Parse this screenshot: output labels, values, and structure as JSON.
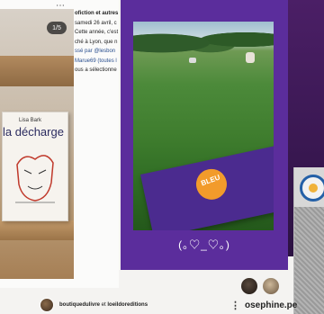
{
  "left_post": {
    "page_indicator": "1/5",
    "book_author": "Lisa Bark",
    "book_title": "la décharge",
    "caption_lines": [
      "ofiction et autres",
      "samedi 26 avril, c",
      "Cette année, c'est",
      "ché à Lyon, que n",
      "ssé par @lesbon",
      "Marue69 (toutes l",
      "ous a sélectionne"
    ],
    "menu_dots": "⋯"
  },
  "story": {
    "kaomoji": "(｡♡_♡｡)",
    "book_title": "BLEU"
  },
  "bottom": {
    "usernames_bold_1": "boutiquedulivre",
    "usernames_and": "et",
    "usernames_bold_2": "loeildoreditions",
    "more_dots": "⋮",
    "right_handle": "osephine.pe"
  }
}
